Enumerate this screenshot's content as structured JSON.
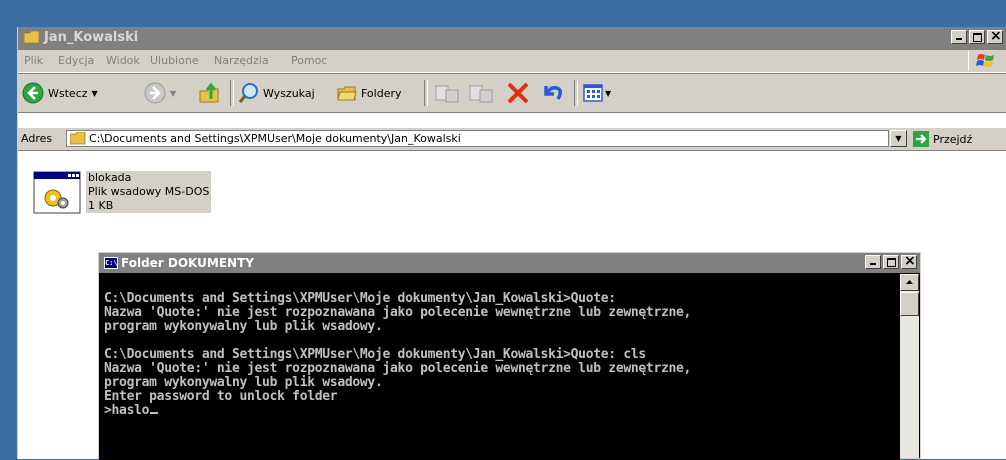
{
  "explorer": {
    "title": "Jan_Kowalski",
    "menu": [
      "Plik",
      "Edycja",
      "Widok",
      "Ulubione",
      "Narzędzia",
      "Pomoc"
    ],
    "toolbar": {
      "back_label": "Wstecz",
      "search_label": "Wyszukaj",
      "folders_label": "Foldery"
    },
    "address": {
      "label": "Adres",
      "value": "C:\\Documents and Settings\\XPMUser\\Moje dokumenty\\Jan_Kowalski",
      "go_label": "Przejdź"
    },
    "file": {
      "name": "blokada",
      "type": "Plik wsadowy MS-DOS",
      "size": "1 KB"
    }
  },
  "console": {
    "title": "Folder DOKUMENTY",
    "icon_text": "C:\\",
    "lines": [
      "C:\\Documents and Settings\\XPMUser\\Moje dokumenty\\Jan_Kowalski>Quote:",
      "Nazwa 'Quote:' nie jest rozpoznawana jako polecenie wewnętrzne lub zewnętrzne,",
      "program wykonywalny lub plik wsadowy.",
      "",
      "C:\\Documents and Settings\\XPMUser\\Moje dokumenty\\Jan_Kowalski>Quote: cls",
      "Nazwa 'Quote:' nie jest rozpoznawana jako polecenie wewnętrzne lub zewnętrzne,",
      "program wykonywalny lub plik wsadowy.",
      "Enter password to unlock folder",
      ">haslo"
    ]
  },
  "colors": {
    "desktop": "#3a6ea5",
    "inactive_title": "#808080",
    "window_face": "#d4d0c8",
    "console_text": "#c0c0c0"
  }
}
